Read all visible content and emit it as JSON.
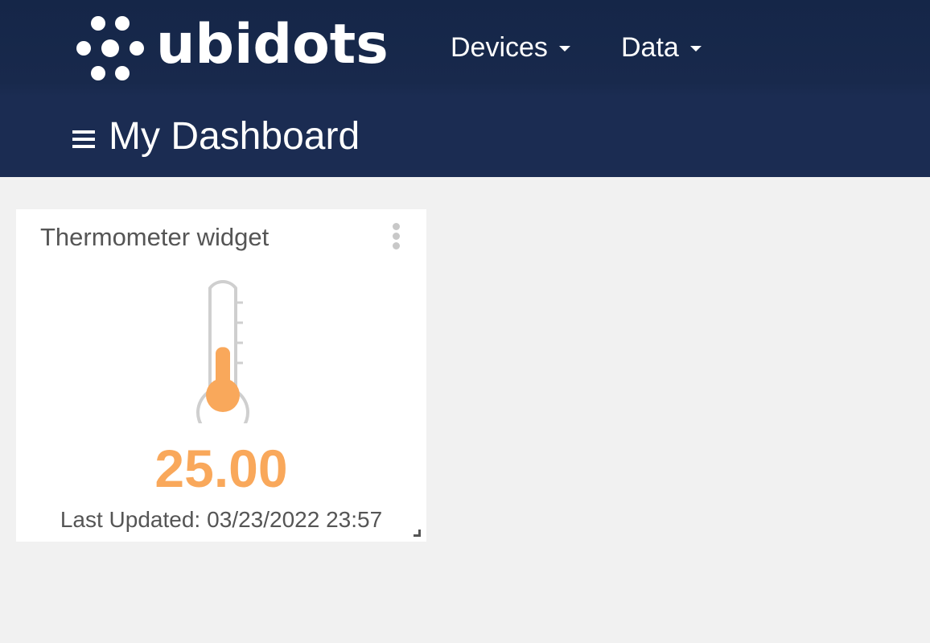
{
  "brand": {
    "name": "ubidots",
    "logo_icon": "ubidots-dots-logo-icon",
    "text_color": "#ffffff"
  },
  "colors": {
    "header_bg": "#18294c",
    "subheader_bg": "#1b2c52",
    "page_bg": "#f1f1f1",
    "widget_bg": "#ffffff",
    "accent_orange": "#f9a85b",
    "muted_gray": "#c8c8c8"
  },
  "nav": {
    "items": [
      {
        "label": "Devices",
        "icon": "chevron-down-icon"
      },
      {
        "label": "Data",
        "icon": "chevron-down-icon"
      }
    ]
  },
  "header": {
    "menu_icon": "hamburger-menu-icon",
    "title": "My Dashboard"
  },
  "widget": {
    "title": "Thermometer widget",
    "options_icon": "kebab-menu-icon",
    "gauge_icon": "thermometer-icon",
    "level_fraction": 0.46,
    "value": "25.00",
    "last_updated_label": "Last Updated:",
    "last_updated_value": "03/23/2022 23:57",
    "resize_icon": "resize-handle-icon"
  }
}
